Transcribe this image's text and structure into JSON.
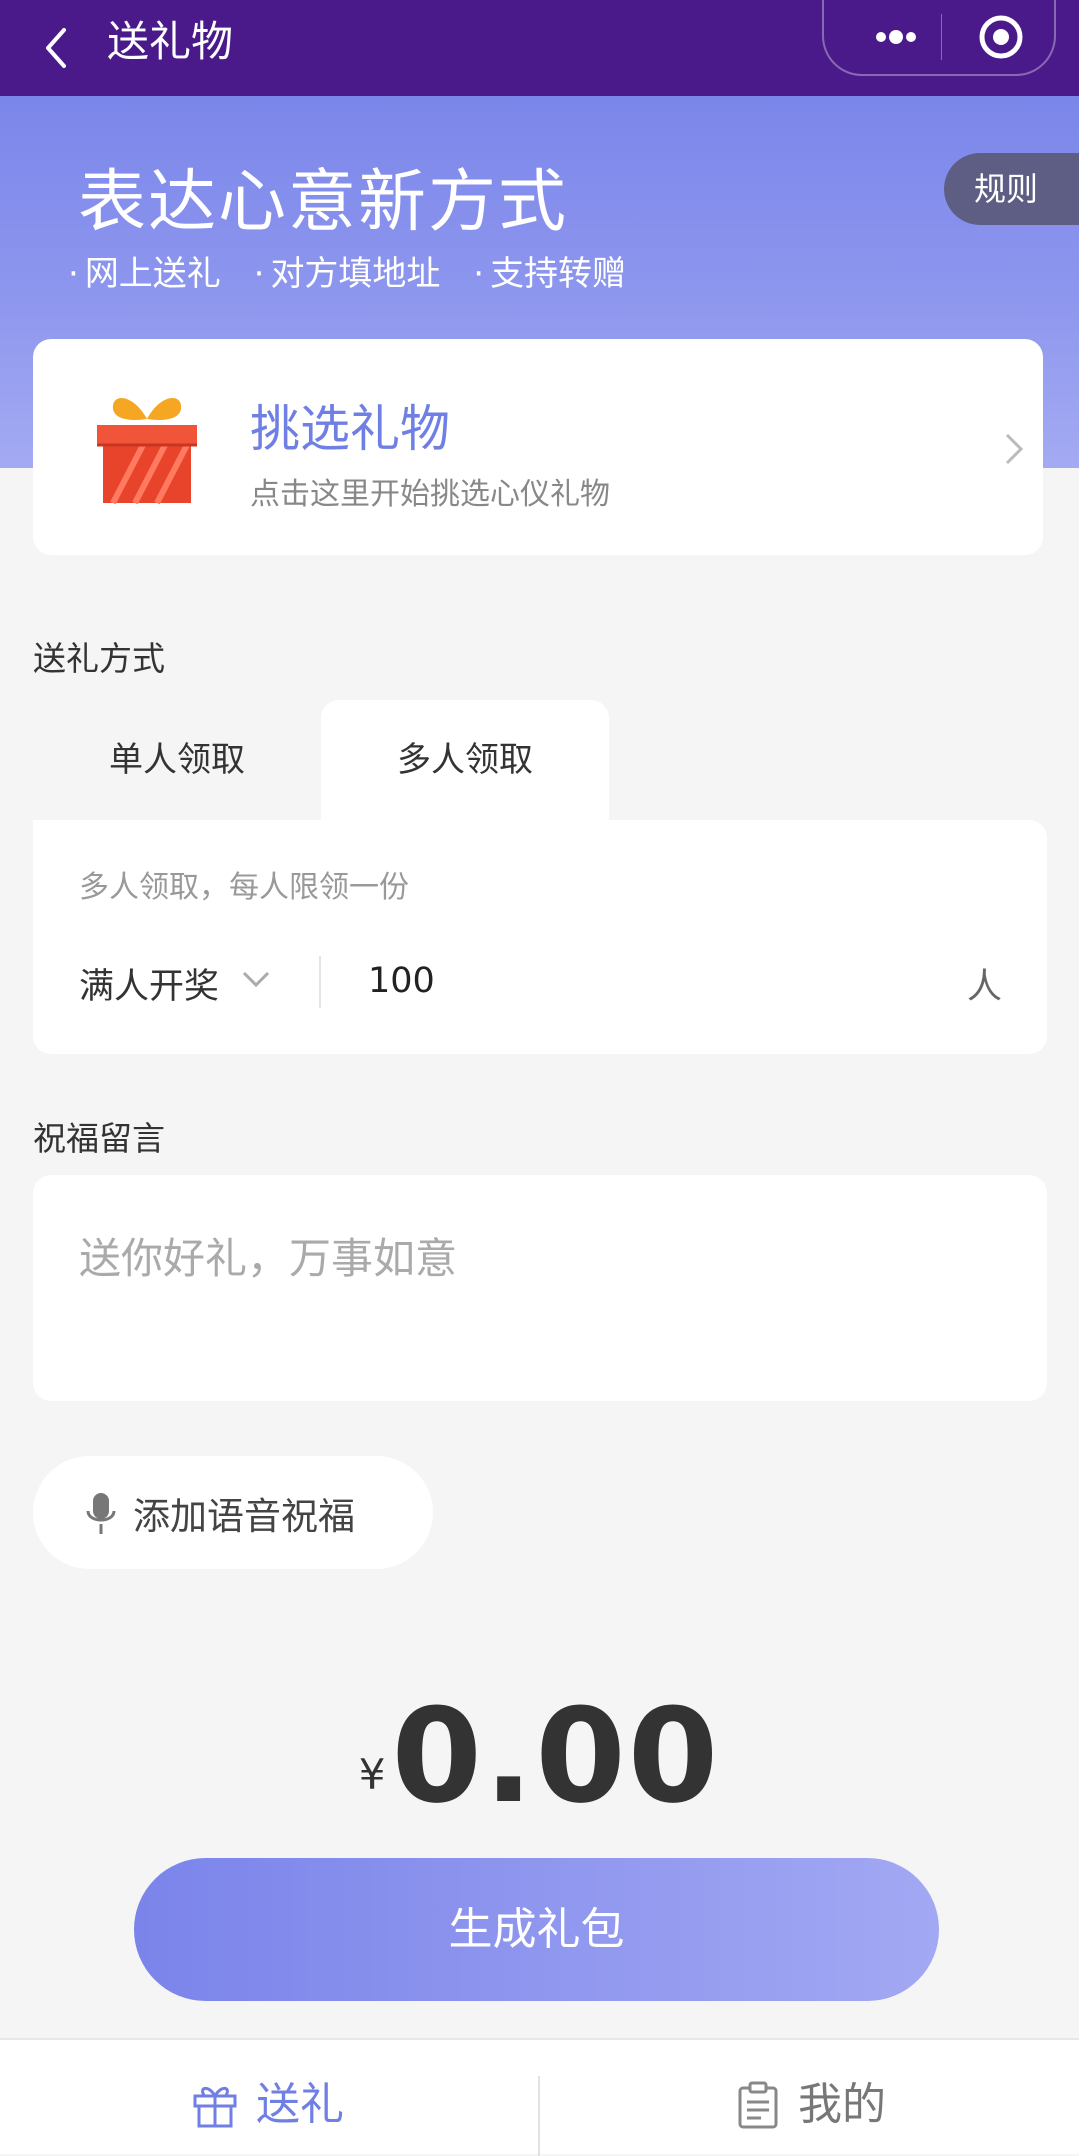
{
  "nav": {
    "title": "送礼物",
    "back_icon": "chevron-left-icon",
    "more_icon": "more-dots-icon",
    "close_icon": "target-circle-icon"
  },
  "hero": {
    "title": "表达心意新方式",
    "tags": [
      "网上送礼",
      "对方填地址",
      "支持转赠"
    ],
    "rules_label": "规则"
  },
  "gift_card": {
    "title": "挑选礼物",
    "subtitle": "点击这里开始挑选心仪礼物",
    "icon": "gift-box-icon"
  },
  "gift_method": {
    "label": "送礼方式",
    "tabs": [
      {
        "label": "单人领取",
        "active": false
      },
      {
        "label": "多人领取",
        "active": true
      }
    ],
    "hint": "多人领取，每人限领一份",
    "mode": "满人开奖",
    "count": "100",
    "unit": "人"
  },
  "message": {
    "label": "祝福留言",
    "placeholder": "送你好礼，万事如意"
  },
  "voice": {
    "label": "添加语音祝福",
    "icon": "microphone-icon"
  },
  "amount": {
    "currency": "¥",
    "value": "0.00"
  },
  "generate_button": "生成礼包",
  "tabbar": {
    "items": [
      {
        "label": "送礼",
        "icon": "gift-icon",
        "active": true
      },
      {
        "label": "我的",
        "icon": "clipboard-icon",
        "active": false
      }
    ]
  },
  "colors": {
    "nav_bg": "#4a1a8a",
    "accent": "#6f7fe3",
    "hero_gradient_top": "#7b86ea",
    "button_gradient_start": "#7b84ea",
    "button_gradient_end": "#a2a8f3"
  }
}
